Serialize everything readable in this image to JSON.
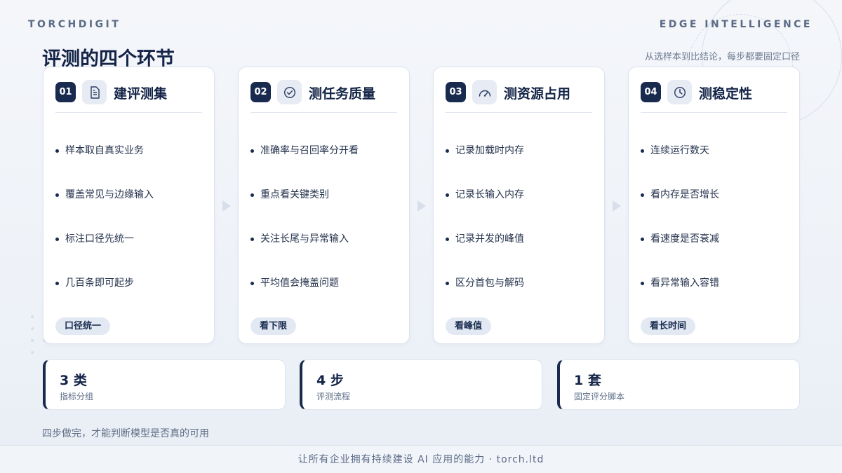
{
  "brand": {
    "left": "TORCHDIGIT",
    "right": "EDGE INTELLIGENCE"
  },
  "header": {
    "title": "评测的四个环节",
    "subtitle": "从选样本到比结论，每步都要固定口径"
  },
  "cards": [
    {
      "number": "01",
      "icon": "document-icon",
      "title": "建评测集",
      "bullets": [
        "样本取自真实业务",
        "覆盖常见与边缘输入",
        "标注口径先统一",
        "几百条即可起步"
      ],
      "tag": "口径统一"
    },
    {
      "number": "02",
      "icon": "check-circle-icon",
      "title": "测任务质量",
      "bullets": [
        "准确率与召回率分开看",
        "重点看关键类别",
        "关注长尾与异常输入",
        "平均值会掩盖问题"
      ],
      "tag": "看下限"
    },
    {
      "number": "03",
      "icon": "gauge-icon",
      "title": "测资源占用",
      "bullets": [
        "记录加载时内存",
        "记录长输入内存",
        "记录并发的峰值",
        "区分首包与解码"
      ],
      "tag": "看峰值"
    },
    {
      "number": "04",
      "icon": "clock-icon",
      "title": "测稳定性",
      "bullets": [
        "连续运行数天",
        "看内存是否增长",
        "看速度是否衰减",
        "看异常输入容错"
      ],
      "tag": "看长时间"
    }
  ],
  "stats": [
    {
      "value": "3 类",
      "label": "指标分组"
    },
    {
      "value": "4 步",
      "label": "评测流程"
    },
    {
      "value": "1 套",
      "label": "固定评分脚本"
    }
  ],
  "footnote": "四步做完，才能判断模型是否真的可用",
  "footer": "让所有企业拥有持续建设 AI 应用的能力 · torch.ltd",
  "colors": {
    "accent": "#182b4f",
    "background": "#eef2f8",
    "card": "#ffffff"
  }
}
